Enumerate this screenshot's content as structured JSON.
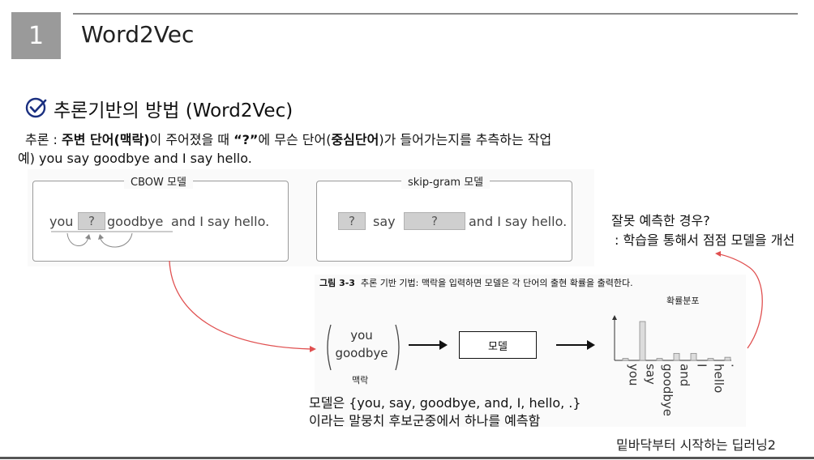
{
  "header": {
    "number": "1",
    "title": "Word2Vec"
  },
  "section": {
    "title": "추론기반의 방법 (Word2Vec)",
    "desc_prefix": "추론 : ",
    "desc_bold1": "주변 단어(맥락)",
    "desc_mid1": "이 주어졌을 때 ",
    "desc_bold2": "“?”",
    "desc_mid2": "에 무슨 단어(",
    "desc_bold3": "중심단어",
    "desc_suffix": ")가 들어가는지를 추측하는 작업",
    "example": "예) you say goodbye and I say hello."
  },
  "figure_top": {
    "cbow": {
      "label": "CBOW 모델",
      "word_you": "you",
      "question": "?",
      "word_goodbye": "goodbye",
      "rest": "and I say hello."
    },
    "skipgram": {
      "label": "skip-gram 모델",
      "question1": "?",
      "word_say": "say",
      "question2": "?",
      "rest": "and I say hello."
    }
  },
  "figure_bottom": {
    "caption_bold": "그림 3-3",
    "caption_text": "추론 기반 기법: 맥락을 입력하면 모델은 각 단어의 출현 확률을 출력한다.",
    "prob_label": "확률분포",
    "context_word1": "you",
    "context_word2": "goodbye",
    "context_label": "맥락",
    "model_label": "모델"
  },
  "chart_data": {
    "type": "bar",
    "categories": [
      "you",
      "say",
      "goodbye",
      "and",
      "I",
      "hello",
      "."
    ],
    "values": [
      0.05,
      1.0,
      0.05,
      0.18,
      0.18,
      0.05,
      0.08
    ],
    "title": "확률분포"
  },
  "notes": {
    "wrong_title": "잘못 예측한 경우?",
    "wrong_desc": ": 학습을 통해서 점점 모델을 개선",
    "candidates_line1": "모델은 {you, say, goodbye, and, I, hello, .}",
    "candidates_line2": "이라는 말뭉치 후보군중에서 하나를 예측함"
  },
  "footer": {
    "source": "밑바닥부터 시작하는 딥러닝2"
  },
  "colors": {
    "accent": "#1a2f80",
    "arrow_red": "#e05050",
    "number_box": "#9a9a9a"
  }
}
